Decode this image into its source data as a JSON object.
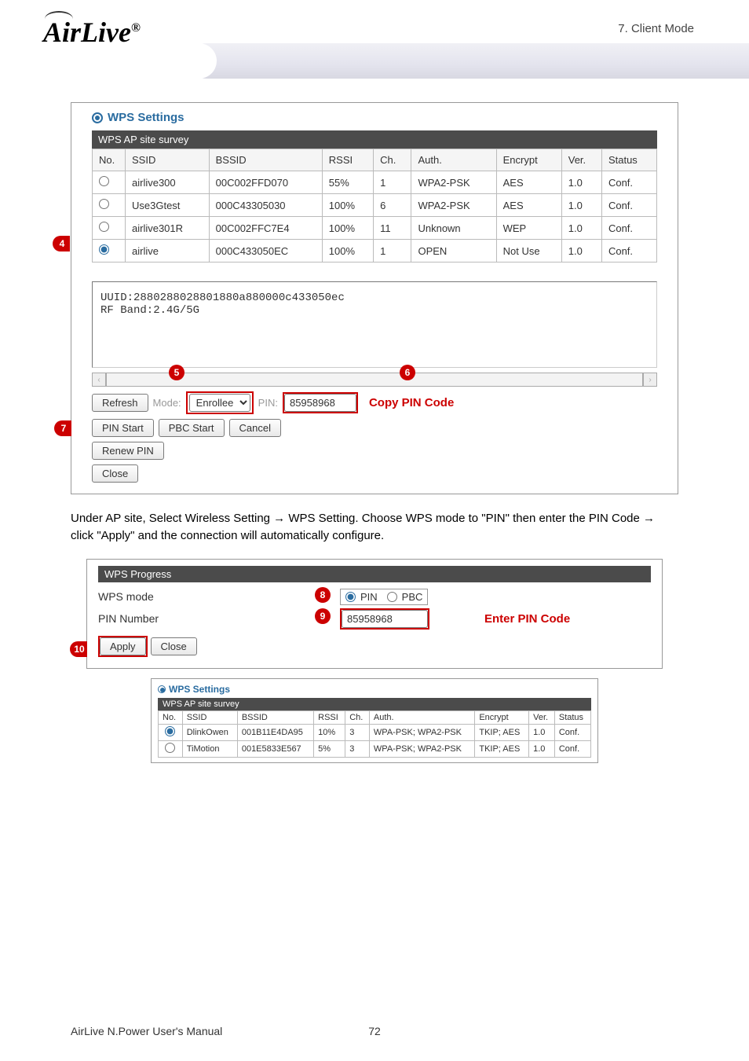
{
  "header": {
    "section_label": "7.  Client  Mode",
    "logo_text": "AirLive",
    "logo_reg": "®"
  },
  "wps_settings": {
    "title": "WPS Settings",
    "survey_header": "WPS AP site survey",
    "columns": [
      "No.",
      "SSID",
      "BSSID",
      "RSSI",
      "Ch.",
      "Auth.",
      "Encrypt",
      "Ver.",
      "Status"
    ],
    "rows": [
      {
        "selected": false,
        "ssid": "airlive300",
        "bssid": "00C002FFD070",
        "rssi": "55%",
        "ch": "1",
        "auth": "WPA2-PSK",
        "encrypt": "AES",
        "ver": "1.0",
        "status": "Conf."
      },
      {
        "selected": false,
        "ssid": "Use3Gtest",
        "bssid": "000C43305030",
        "rssi": "100%",
        "ch": "6",
        "auth": "WPA2-PSK",
        "encrypt": "AES",
        "ver": "1.0",
        "status": "Conf."
      },
      {
        "selected": false,
        "ssid": "airlive301R",
        "bssid": "00C002FFC7E4",
        "rssi": "100%",
        "ch": "11",
        "auth": "Unknown",
        "encrypt": "WEP",
        "ver": "1.0",
        "status": "Conf."
      },
      {
        "selected": true,
        "ssid": "airlive",
        "bssid": "000C433050EC",
        "rssi": "100%",
        "ch": "1",
        "auth": "OPEN",
        "encrypt": "Not Use",
        "ver": "1.0",
        "status": "Conf."
      }
    ],
    "uuid_line": "UUID:2880288028801880a880000c433050ec",
    "rf_band_line": "RF Band:2.4G/5G",
    "buttons": {
      "refresh": "Refresh",
      "mode_label": "Mode:",
      "mode_value": "Enrollee",
      "pin_label": "PIN:",
      "pin_value": "85958968",
      "copy_pin": "Copy PIN Code",
      "pin_start": "PIN Start",
      "pbc_start": "PBC Start",
      "cancel": "Cancel",
      "renew_pin": "Renew PIN",
      "close": "Close"
    },
    "callouts": {
      "c4": "4",
      "c5": "5",
      "c6": "6",
      "c7": "7"
    }
  },
  "instructions": "Under AP site, Select Wireless Setting → WPS Setting.    Choose WPS mode to \"PIN\" then enter the PIN Code → click \"Apply\" and the connection will automatically configure.",
  "wps_progress": {
    "header": "WPS Progress",
    "mode_label": "WPS mode",
    "pin_radio": "PIN",
    "pbc_radio": "PBC",
    "pin_number_label": "PIN Number",
    "pin_number_value": "85958968",
    "enter_pin": "Enter PIN Code",
    "apply": "Apply",
    "close": "Close",
    "callouts": {
      "c8": "8",
      "c9": "9",
      "c10": "10"
    }
  },
  "wps_settings_small": {
    "title": "WPS Settings",
    "survey_header": "WPS AP site survey",
    "columns": [
      "No.",
      "SSID",
      "BSSID",
      "RSSI",
      "Ch.",
      "Auth.",
      "Encrypt",
      "Ver.",
      "Status"
    ],
    "rows": [
      {
        "selected": true,
        "ssid": "DlinkOwen",
        "bssid": "001B11E4DA95",
        "rssi": "10%",
        "ch": "3",
        "auth": "WPA-PSK; WPA2-PSK",
        "encrypt": "TKIP; AES",
        "ver": "1.0",
        "status": "Conf."
      },
      {
        "selected": false,
        "ssid": "TiMotion",
        "bssid": "001E5833E567",
        "rssi": "5%",
        "ch": "3",
        "auth": "WPA-PSK; WPA2-PSK",
        "encrypt": "TKIP; AES",
        "ver": "1.0",
        "status": "Conf."
      }
    ]
  },
  "footer": {
    "manual_name": "AirLive N.Power User's Manual",
    "page_number": "72"
  }
}
